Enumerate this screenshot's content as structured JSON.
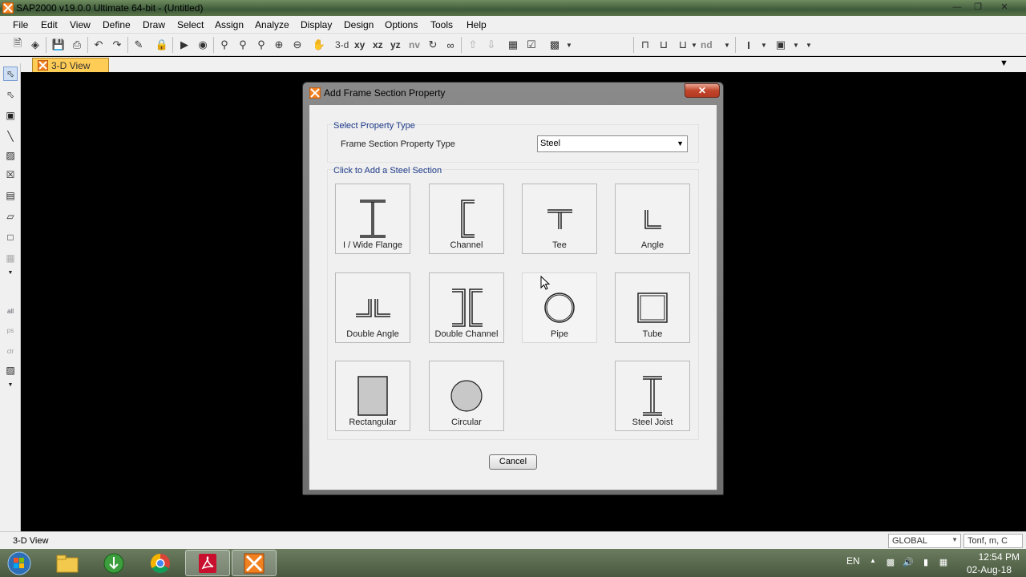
{
  "window": {
    "title": "SAP2000 v19.0.0 Ultimate 64-bit - (Untitled)"
  },
  "menu": [
    "File",
    "Edit",
    "View",
    "Define",
    "Draw",
    "Select",
    "Assign",
    "Analyze",
    "Display",
    "Design",
    "Options",
    "Tools",
    "Help"
  ],
  "toolbar": {
    "view_3d": "3-d",
    "view_xy": "xy",
    "view_xz": "xz",
    "view_yz": "yz",
    "view_nv": "nv",
    "nd": "nd"
  },
  "tab": {
    "label": "3-D View"
  },
  "dialog": {
    "title": "Add Frame Section Property",
    "group1_title": "Select Property Type",
    "prop_type_label": "Frame Section Property Type",
    "prop_type_value": "Steel",
    "group2_title": "Click to Add a Steel Section",
    "sections": {
      "i_wide_flange": "I / Wide Flange",
      "channel": "Channel",
      "tee": "Tee",
      "angle": "Angle",
      "double_angle": "Double Angle",
      "double_channel": "Double Channel",
      "pipe": "Pipe",
      "tube": "Tube",
      "rectangular": "Rectangular",
      "circular": "Circular",
      "steel_joist": "Steel Joist"
    },
    "cancel_label": "Cancel"
  },
  "statusbar": {
    "view_label": "3-D View",
    "coord_system": "GLOBAL",
    "units": "Tonf, m, C"
  },
  "taskbar": {
    "language": "EN",
    "time": "12:54 PM",
    "date": "02-Aug-18"
  },
  "colors": {
    "accent_tab": "#ffcc55",
    "group_title": "#1e3b8a",
    "close_button": "#c1452b"
  }
}
